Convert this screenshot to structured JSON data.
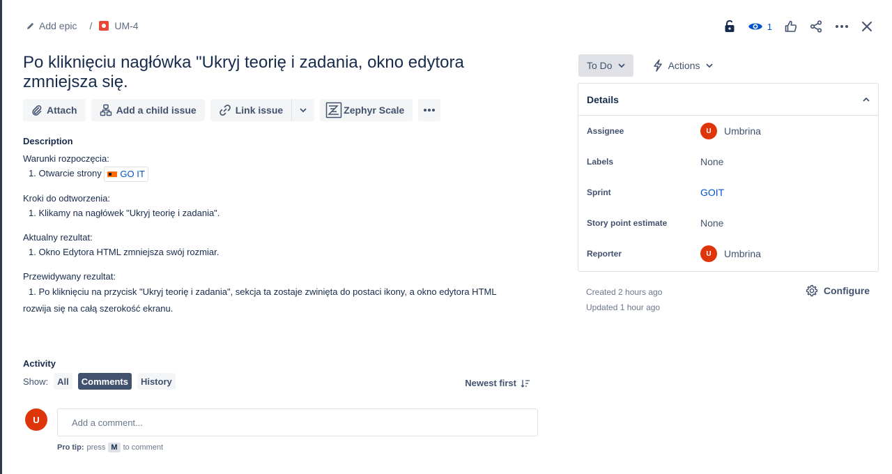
{
  "breadcrumb": {
    "epic_label": "Add epic",
    "separator": "/",
    "issue_key": "UM-4"
  },
  "header_actions": {
    "watch_count": "1"
  },
  "issue": {
    "title": "Po kliknięciu nagłówka \"Ukryj teorię i zadania, okno edytora zmniejsza się."
  },
  "toolbar": {
    "attach": "Attach",
    "add_child": "Add a child issue",
    "link_issue": "Link issue",
    "zephyr": "Zephyr Scale"
  },
  "description": {
    "heading": "Description",
    "sections": [
      {
        "title": "Warunki rozpoczęcia:",
        "item_prefix": "1. Otwarcie strony",
        "link_text": "GO IT"
      },
      {
        "title": "Kroki do odtworzenia:",
        "item": "1. Klikamy na nagłówek \"Ukryj teorię i zadania\"."
      },
      {
        "title": "Aktualny rezultat:",
        "item": "1. Okno Edytora HTML zmniejsza swój rozmiar."
      },
      {
        "title": "Przewidywany rezultat:",
        "item": "1. Po kliknięciu na przycisk \"Ukryj teorię i zadania\", sekcja ta zostaje zwinięta do postaci ikony, a okno edytora HTML",
        "item_cont": "rozwija się na całą szerokość ekranu."
      }
    ]
  },
  "activity": {
    "heading": "Activity",
    "show_label": "Show:",
    "filters": [
      "All",
      "Comments",
      "History"
    ],
    "active_filter": "Comments",
    "sort_label": "Newest first",
    "comment_placeholder": "Add a comment...",
    "protip_bold": "Pro tip:",
    "protip_press": "press",
    "protip_key": "M",
    "protip_rest": "to comment",
    "user_initial": "U"
  },
  "sidebar": {
    "status": "To Do",
    "actions": "Actions",
    "details_title": "Details",
    "fields": [
      {
        "label": "Assignee",
        "value": "Umbrina",
        "avatar": "U"
      },
      {
        "label": "Labels",
        "value": "None"
      },
      {
        "label": "Sprint",
        "value": "GOIT"
      },
      {
        "label": "Story point estimate",
        "value": "None"
      },
      {
        "label": "Reporter",
        "value": "Umbrina",
        "avatar": "U"
      }
    ],
    "created": "Created 2 hours ago",
    "updated": "Updated 1 hour ago",
    "configure": "Configure"
  },
  "colors": {
    "accent": "#0052cc",
    "avatar": "#de350b",
    "bug": "#e5493a",
    "text": "#172b4d"
  }
}
